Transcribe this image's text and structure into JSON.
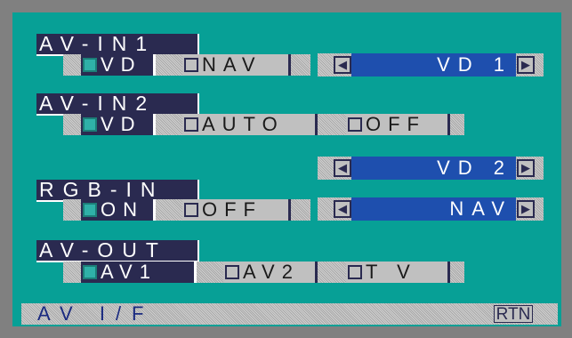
{
  "sections": {
    "av_in1": {
      "title": "AV-IN1",
      "options": [
        {
          "label": "VD",
          "selected": true
        },
        {
          "label": "NAV",
          "selected": false
        }
      ],
      "selector_value": "VD 1"
    },
    "av_in2": {
      "title": "AV-IN2",
      "options": [
        {
          "label": "VD",
          "selected": true
        },
        {
          "label": "AUTO",
          "selected": false
        },
        {
          "label": "OFF",
          "selected": false
        }
      ],
      "selector_value": "VD 2"
    },
    "rgb_in": {
      "title": "RGB-IN",
      "options": [
        {
          "label": "ON",
          "selected": true
        },
        {
          "label": "OFF",
          "selected": false
        }
      ],
      "selector_value": "NAV"
    },
    "av_out": {
      "title": "AV-OUT",
      "options": [
        {
          "label": "AV1",
          "selected": true
        },
        {
          "label": "AV2",
          "selected": false
        },
        {
          "label": "T V",
          "selected": false
        }
      ]
    }
  },
  "footer": {
    "title": "AV I/F",
    "return_label": "RTN"
  },
  "colors": {
    "background": "#07a096",
    "frame": "#808080",
    "header_bg": "#2a2a50",
    "selector_bg": "#1e4fae"
  },
  "icons": {
    "prev": "left-triangle",
    "next": "right-triangle",
    "checkbox": "square"
  }
}
